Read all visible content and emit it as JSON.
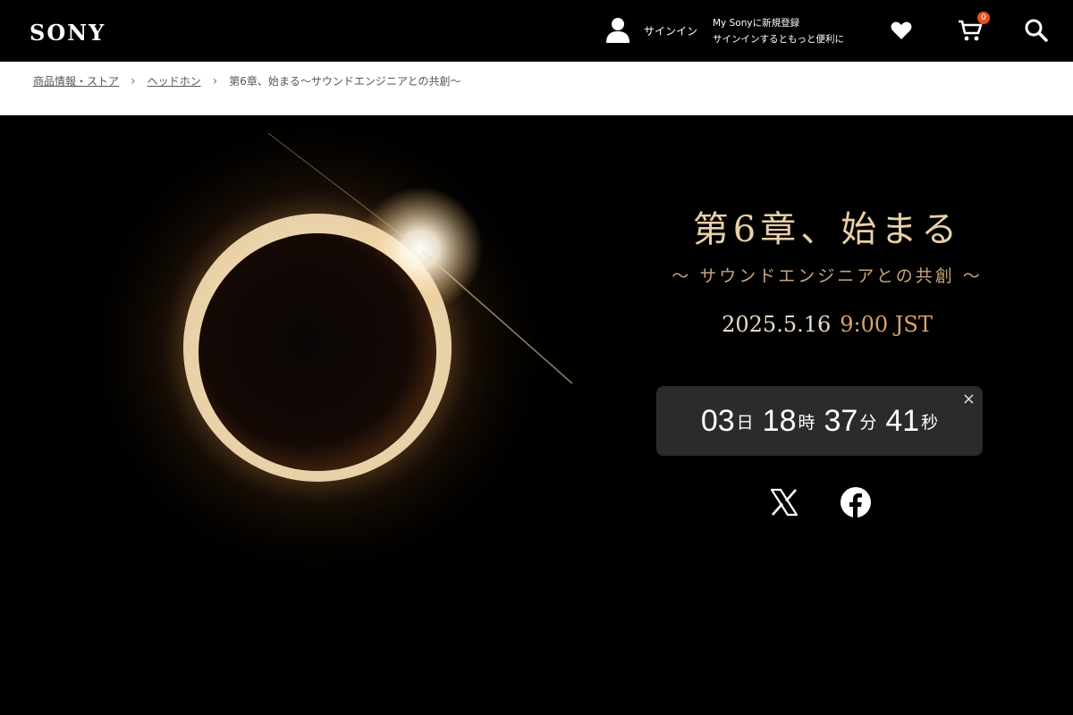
{
  "header": {
    "logo": "SONY",
    "signin_label": "サインイン",
    "mysony_line1": "My Sonyに新規登録",
    "mysony_line2": "サインインするともっと便利に",
    "cart_count": "0",
    "icons": [
      "user-icon",
      "heart-icon",
      "cart-icon",
      "search-icon"
    ]
  },
  "breadcrumb": {
    "items": [
      "商品情報・ストア",
      "ヘッドホン"
    ],
    "separator": "›",
    "current": "第6章、始まる〜サウンドエンジニアとの共創〜"
  },
  "hero": {
    "title": "第6章、始まる",
    "subtitle": "〜 サウンドエンジニアとの共創 〜",
    "date": "2025.5.16",
    "time": "9:00 JST",
    "countdown": {
      "days": "03",
      "days_unit": "日",
      "hours": "18",
      "hours_unit": "時",
      "minutes": "37",
      "minutes_unit": "分",
      "seconds": "41",
      "seconds_unit": "秒",
      "close_label": "×"
    },
    "share_icons": [
      "x-icon",
      "facebook-icon"
    ]
  },
  "colors": {
    "title": "#e8cfa8",
    "subtitle": "#c9a57a",
    "time_accent": "#d9a46a",
    "countdown_bg": "#2b2b2b",
    "badge": "#e8501c"
  }
}
